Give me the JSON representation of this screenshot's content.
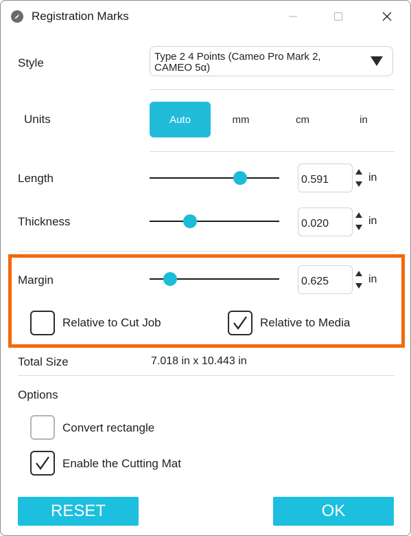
{
  "window": {
    "title": "Registration Marks",
    "icon": "silhouette-app-icon"
  },
  "style": {
    "label": "Style",
    "value": "Type 2 4 Points (Cameo Pro Mark 2, CAMEO 5α)"
  },
  "units": {
    "label": "Units",
    "options": [
      "Auto",
      "mm",
      "cm",
      "in"
    ],
    "selected": "Auto"
  },
  "length": {
    "label": "Length",
    "value": "0.591",
    "unit": "in",
    "slider_fraction": 0.7
  },
  "thickness": {
    "label": "Thickness",
    "value": "0.020",
    "unit": "in",
    "slider_fraction": 0.31
  },
  "margin": {
    "label": "Margin",
    "value": "0.625",
    "unit": "in",
    "slider_fraction": 0.16,
    "relative_to_cut_job": {
      "label": "Relative to Cut Job",
      "checked": false
    },
    "relative_to_media": {
      "label": "Relative to Media",
      "checked": true
    }
  },
  "total_size": {
    "label": "Total Size",
    "value": "7.018 in x 10.443 in"
  },
  "options": {
    "label": "Options",
    "convert_rectangle": {
      "label": "Convert rectangle",
      "checked": false
    },
    "enable_cutting_mat": {
      "label": "Enable the Cutting Mat",
      "checked": true
    }
  },
  "buttons": {
    "reset": "RESET",
    "ok": "OK"
  },
  "colors": {
    "accent": "#1cbfde",
    "highlight": "#f26a09"
  }
}
